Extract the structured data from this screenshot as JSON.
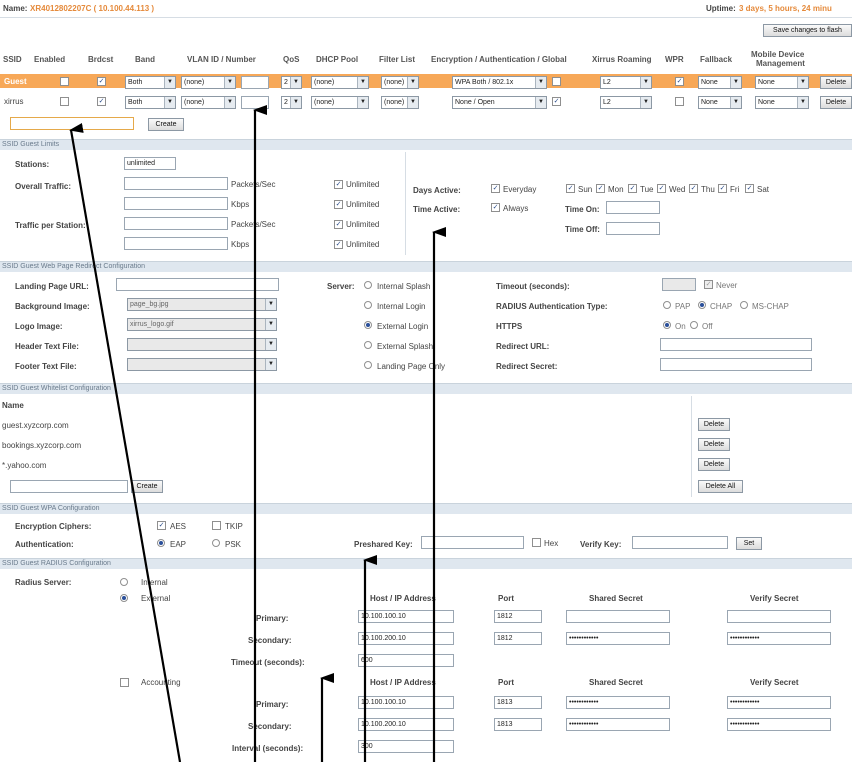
{
  "header": {
    "name_label": "Name:",
    "name_value": "XR4012802207C  ( 10.100.44.113 )",
    "uptime_label": "Uptime:",
    "uptime_value": "3 days, 5 hours, 24 minu",
    "save_button": "Save changes to flash"
  },
  "ssid_table": {
    "columns": [
      "SSID",
      "Enabled",
      "Brdcst",
      "Band",
      "VLAN ID / Number",
      "QoS",
      "DHCP Pool",
      "Filter List",
      "Encryption / Authentication / Global",
      "Xirrus Roaming",
      "WPR",
      "Fallback",
      "Mobile Device",
      "Management"
    ],
    "rows": [
      {
        "ssid": "Guest",
        "enabled": false,
        "brdcst": true,
        "band": "Both",
        "vlan": "(none)",
        "vlan_num": "",
        "qos": "2",
        "dhcp": "(none)",
        "filter": "(none)",
        "encryption": "WPA Both / 802.1x",
        "global": false,
        "roaming": "L2",
        "wpr": true,
        "fallback": "None",
        "mdm": "None",
        "delete": "Delete"
      },
      {
        "ssid": "xirrus",
        "enabled": false,
        "brdcst": true,
        "band": "Both",
        "vlan": "(none)",
        "vlan_num": "",
        "qos": "2",
        "dhcp": "(none)",
        "filter": "(none)",
        "encryption": "None / Open",
        "global": true,
        "roaming": "L2",
        "wpr": false,
        "fallback": "None",
        "mdm": "None",
        "delete": "Delete"
      }
    ],
    "new_ssid_value": "",
    "create_button": "Create"
  },
  "limits": {
    "band": "SSID Guest  Limits",
    "stations_label": "Stations:",
    "stations_value": "unlimited",
    "overall_label": "Overall Traffic:",
    "per_station_label": "Traffic per Station:",
    "packets_unit": "Packets/Sec",
    "kbps_unit": "Kbps",
    "unlimited": "Unlimited",
    "days_label": "Days Active:",
    "time_label": "Time Active:",
    "everyday": "Everyday",
    "always": "Always",
    "days": [
      "Sun",
      "Mon",
      "Tue",
      "Wed",
      "Thu",
      "Fri",
      "Sat"
    ],
    "time_on": "Time On:",
    "time_off": "Time Off:"
  },
  "redirect": {
    "band": "SSID Guest  Web Page Redirect Configuration",
    "landing_label": "Landing Page URL:",
    "bg_label": "Background Image:",
    "bg_value": "page_bg.jpg",
    "logo_label": "Logo Image:",
    "logo_value": "xirrus_logo.gif",
    "header_label": "Header Text File:",
    "footer_label": "Footer Text File:",
    "server_label": "Server:",
    "servers": [
      "Internal Splash",
      "Internal Login",
      "External Login",
      "External Splash",
      "Landing Page Only"
    ],
    "timeout_label": "Timeout (seconds):",
    "never": "Never",
    "radius_auth_label": "RADIUS Authentication Type:",
    "pap": "PAP",
    "chap": "CHAP",
    "mschap": "MS-CHAP",
    "https_label": "HTTPS",
    "on": "On",
    "off": "Off",
    "redirect_url_label": "Redirect URL:",
    "redirect_secret_label": "Redirect Secret:"
  },
  "whitelist": {
    "band": "SSID Guest  Whitelist Configuration",
    "name_header": "Name",
    "items": [
      "guest.xyzcorp.com",
      "bookings.xyzcorp.com",
      "*.yahoo.com"
    ],
    "delete": "Delete",
    "delete_all": "Delete All",
    "create": "Create"
  },
  "wpa": {
    "band": "SSID Guest  WPA Configuration",
    "ciphers_label": "Encryption Ciphers:",
    "aes": "AES",
    "tkip": "TKIP",
    "auth_label": "Authentication:",
    "eap": "EAP",
    "psk": "PSK",
    "preshared_label": "Preshared Key:",
    "hex": "Hex",
    "verify_label": "Verify Key:",
    "set": "Set"
  },
  "radius": {
    "band": "SSID Guest  RADIUS Configuration",
    "server_label": "Radius Server:",
    "internal": "Internal",
    "external": "External",
    "host_header": "Host / IP Address",
    "port_header": "Port",
    "secret_header": "Shared Secret",
    "verify_header": "Verify Secret",
    "primary": "Primary:",
    "secondary": "Secondary:",
    "timeout_label": "Timeout (seconds):",
    "timeout_value": "600",
    "accounting": "Accounting",
    "interval_label": "Interval (seconds):",
    "interval_value": "300",
    "auth_primary_host": "10.100.100.10",
    "auth_primary_port": "1812",
    "auth_secondary_host": "10.100.200.10",
    "auth_secondary_port": "1812",
    "acct_primary_host": "10.100.100.10",
    "acct_primary_port": "1813",
    "acct_secondary_host": "10.100.200.10",
    "acct_secondary_port": "1813",
    "masked": "••••••••••••"
  }
}
